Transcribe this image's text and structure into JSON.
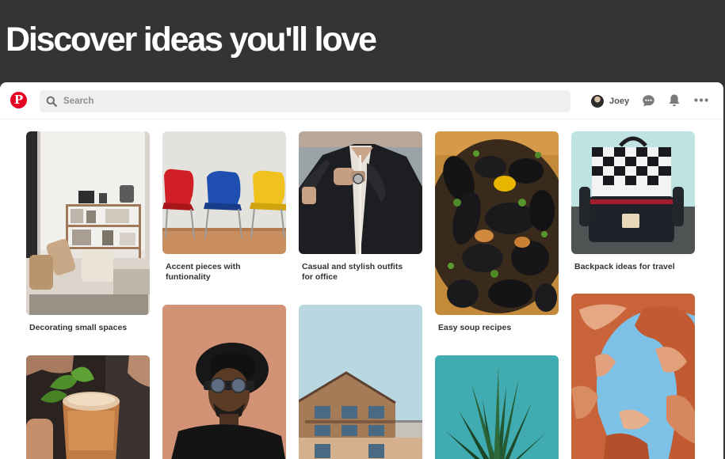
{
  "headline": "Discover ideas you'll love",
  "topbar": {
    "logo_letter": "P",
    "search_placeholder": "Search",
    "user_name": "Joey"
  },
  "pins": [
    {
      "title": "Decorating small spaces",
      "image": "living room with shelves and chairs"
    },
    {
      "title": "Accent pieces with funtionality",
      "image": "red, blue and yellow chairs"
    },
    {
      "title": "Casual and stylish outfits for office",
      "image": "man in black jacket"
    },
    {
      "title": "Easy soup recipes",
      "image": "mussels in bowl"
    },
    {
      "title": "Backpack ideas for travel",
      "image": "checkered backpack"
    },
    {
      "title": "",
      "image": "copper mug cocktail with mint"
    },
    {
      "title": "",
      "image": "man with hat and sunglasses"
    },
    {
      "title": "",
      "image": "wooden building facade"
    },
    {
      "title": "",
      "image": "green plant on teal background"
    },
    {
      "title": "",
      "image": "red rock arch"
    }
  ],
  "colors": {
    "brand": "#e60023",
    "background": "#343434",
    "surface": "#ffffff"
  }
}
